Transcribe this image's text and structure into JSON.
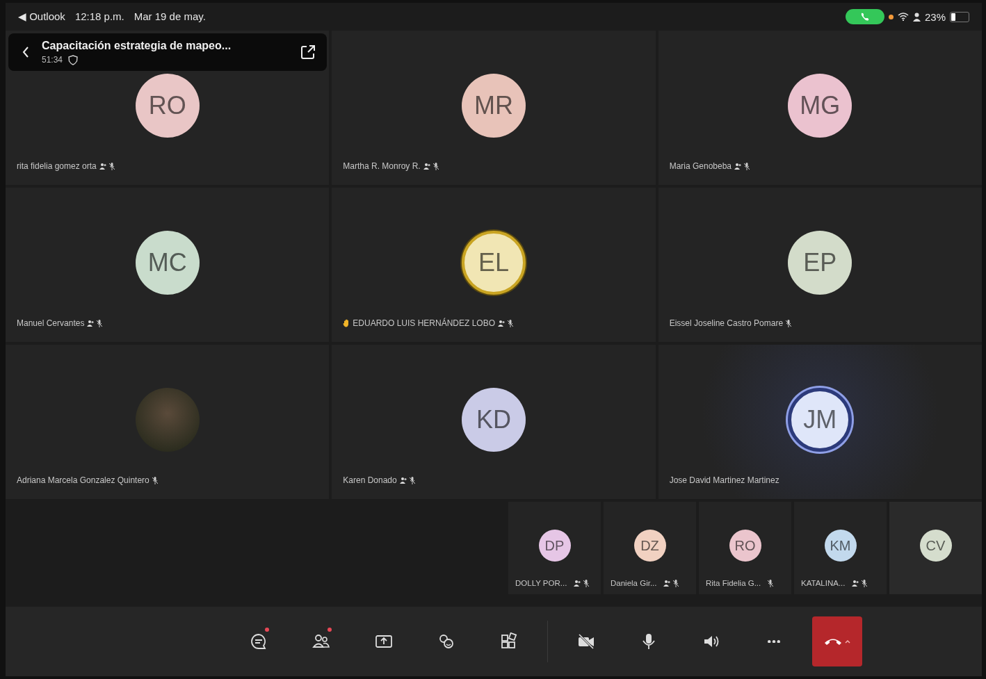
{
  "status_bar": {
    "back_app": "◀ Outlook",
    "time": "12:18 p.m.",
    "date": "Mar 19 de may.",
    "call_active": true,
    "battery": "23%"
  },
  "meeting": {
    "title": "Capacitación estrategia de mapeo...",
    "duration": "51:34"
  },
  "participants": [
    {
      "kind": "initials",
      "initials": "RO",
      "name": "rita fidelia gomez orta",
      "color": "#e9c6c6",
      "hand_raised": false,
      "speaking": false,
      "status_icons": [
        {
          "kind": "people"
        },
        {
          "kind": "mic_off"
        }
      ]
    },
    {
      "kind": "initials",
      "initials": "MR",
      "name": "Martha R. Monroy R.",
      "color": "#e8c3b9",
      "hand_raised": false,
      "speaking": false,
      "status_icons": [
        {
          "kind": "people"
        },
        {
          "kind": "mic_off"
        }
      ]
    },
    {
      "kind": "initials",
      "initials": "MG",
      "name": "Maria Genobeba",
      "color": "#ebc2cf",
      "hand_raised": false,
      "speaking": false,
      "status_icons": [
        {
          "kind": "people"
        },
        {
          "kind": "mic_off"
        }
      ]
    },
    {
      "kind": "initials",
      "initials": "MC",
      "name": "Manuel Cervantes",
      "color": "#c9dccc",
      "hand_raised": false,
      "speaking": false,
      "status_icons": [
        {
          "kind": "people"
        },
        {
          "kind": "mic_off"
        }
      ]
    },
    {
      "kind": "initials",
      "initials": "EL",
      "name": "EDUARDO LUIS HERNÁNDEZ  LOBO",
      "color": "#f1e6b4",
      "hand_raised": true,
      "speaking": false,
      "status_icons": [
        {
          "kind": "people"
        },
        {
          "kind": "mic_off"
        }
      ]
    },
    {
      "kind": "initials",
      "initials": "EP",
      "name": "Eissel Joseline Castro Pomare",
      "color": "#d3dcca",
      "hand_raised": false,
      "speaking": false,
      "status_icons": [
        {
          "kind": "mic_off"
        }
      ]
    },
    {
      "kind": "photo",
      "name": "Adriana Marcela Gonzalez Quintero",
      "hand_raised": false,
      "speaking": false,
      "status_icons": [
        {
          "kind": "mic_off"
        }
      ]
    },
    {
      "kind": "initials",
      "initials": "KD",
      "name": "Karen Donado",
      "color": "#cacbe7",
      "hand_raised": false,
      "speaking": false,
      "status_icons": [
        {
          "kind": "people"
        },
        {
          "kind": "mic_off"
        }
      ]
    },
    {
      "kind": "initials",
      "initials": "JM",
      "name": "Jose David Martinez Martinez",
      "color": "#dfe6f9",
      "hand_raised": false,
      "speaking": true
    }
  ],
  "small_participants": [
    {
      "kind": "initials",
      "initials": "DP",
      "name": "DOLLY POR...",
      "color": "#e6c6e6",
      "status_icons": [
        {
          "kind": "people"
        },
        {
          "kind": "mic_off"
        }
      ]
    },
    {
      "kind": "initials",
      "initials": "DZ",
      "name": "Daniela Gir...",
      "color": "#f1d1c1",
      "status_icons": [
        {
          "kind": "people"
        },
        {
          "kind": "mic_off"
        }
      ]
    },
    {
      "kind": "initials",
      "initials": "RO",
      "name": "Rita Fidelia G...",
      "color": "#ebc5cd",
      "status_icons": [
        {
          "kind": "mic_off"
        }
      ]
    },
    {
      "kind": "initials",
      "initials": "KM",
      "name": "KATALINA...",
      "color": "#c2d9ed",
      "status_icons": [
        {
          "kind": "people"
        },
        {
          "kind": "mic_off"
        }
      ]
    },
    {
      "kind": "initials",
      "initials": "CV",
      "color": "#d5ddcd"
    }
  ],
  "toolbar": [
    {
      "kind": "chat",
      "badge": true
    },
    {
      "kind": "people",
      "badge": true
    },
    {
      "kind": "share",
      "badge": false
    },
    {
      "kind": "reactions",
      "badge": false
    },
    {
      "kind": "apps",
      "badge": false
    },
    {
      "kind": "divider"
    },
    {
      "kind": "camera_off",
      "badge": false
    },
    {
      "kind": "mic",
      "badge": false
    },
    {
      "kind": "speaker",
      "badge": false
    },
    {
      "kind": "more",
      "badge": false
    },
    {
      "kind": "hang_up",
      "badge": false
    }
  ]
}
